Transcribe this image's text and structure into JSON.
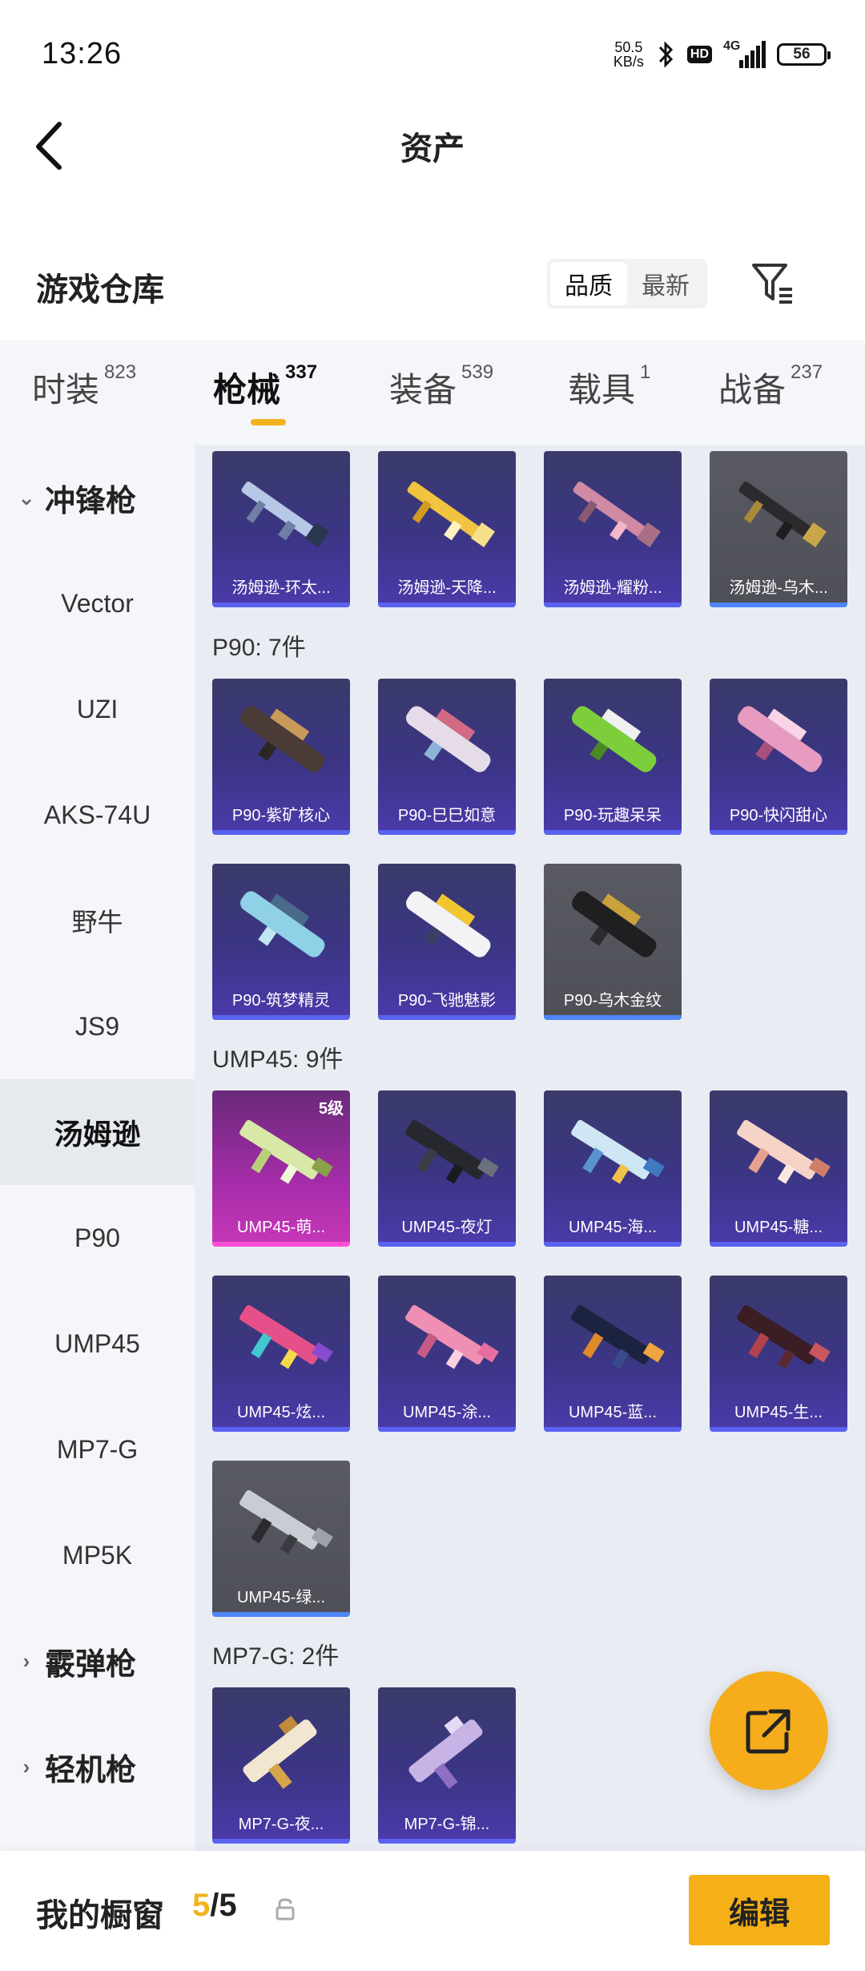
{
  "status_bar": {
    "time": "13:26",
    "net_speed_value": "50.5",
    "net_speed_unit": "KB/s",
    "hd": "HD",
    "network": "4G",
    "battery": "56"
  },
  "header": {
    "title": "资产"
  },
  "section": {
    "title": "游戏仓库",
    "sort_options": [
      "品质",
      "最新"
    ],
    "active_sort": "品质"
  },
  "tabs": [
    {
      "label": "时装",
      "count": "823"
    },
    {
      "label": "枪械",
      "count": "337"
    },
    {
      "label": "装备",
      "count": "539"
    },
    {
      "label": "载具",
      "count": "1"
    },
    {
      "label": "战备",
      "count": "237"
    }
  ],
  "active_tab": "枪械",
  "sidebar": {
    "groups": [
      {
        "label": "冲锋枪",
        "expanded": true
      },
      {
        "label": "霰弹枪",
        "expanded": false
      },
      {
        "label": "轻机枪",
        "expanded": false
      }
    ],
    "items": [
      "Vector",
      "UZI",
      "AKS-74U",
      "野牛",
      "JS9",
      "汤姆逊",
      "P90",
      "UMP45",
      "MP7-G",
      "MP5K"
    ],
    "active_item": "汤姆逊"
  },
  "content": {
    "thompson_cards": [
      "汤姆逊-环太...",
      "汤姆逊-天降...",
      "汤姆逊-耀粉...",
      "汤姆逊-乌木..."
    ],
    "p90": {
      "heading": "P90: 7件",
      "cards": [
        "P90-紫矿核心",
        "P90-巳巳如意",
        "P90-玩趣呆呆",
        "P90-快闪甜心",
        "P90-筑梦精灵",
        "P90-飞驰魅影",
        "P90-乌木金纹"
      ]
    },
    "ump45": {
      "heading": "UMP45: 9件",
      "cards": [
        "UMP45-萌...",
        "UMP45-夜灯",
        "UMP45-海...",
        "UMP45-糖...",
        "UMP45-炫...",
        "UMP45-涂...",
        "UMP45-蓝...",
        "UMP45-生...",
        "UMP45-绿..."
      ],
      "first_card_level": "5级"
    },
    "mp7g": {
      "heading": "MP7-G: 2件",
      "cards": [
        "MP7-G-夜...",
        "MP7-G-锦..."
      ]
    }
  },
  "bottom_bar": {
    "label": "我的橱窗",
    "current": "5",
    "separator": "/",
    "total": "5",
    "edit_label": "编辑"
  },
  "colors": {
    "accent": "#f2b31a",
    "card_purple": "#3b3584",
    "card_gray": "#4e4f57",
    "card_pink": "#a42ca8",
    "sidebar_bg": "#f4f6f9",
    "content_bg": "#e9edf3"
  }
}
